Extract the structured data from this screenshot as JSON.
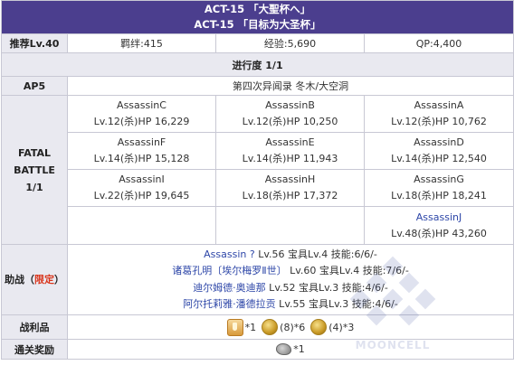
{
  "header": {
    "line1": "ACT-15 「大聖杯へ」",
    "line2": "ACT-15 「目标为大圣杯」"
  },
  "stats": {
    "recommend": "推荐Lv.40",
    "bond": "羁绊:415",
    "exp": "经验:5,690",
    "qp": "QP:4,400"
  },
  "progress": "进行度 1/1",
  "ap": {
    "label": "AP5",
    "location": "第四次异闻录 冬木/大空洞"
  },
  "battle": {
    "label_line1": "FATAL",
    "label_line2": "BATTLE",
    "label_line3": "1/1",
    "rows": [
      [
        {
          "name": "AssassinC",
          "stats": "Lv.12(杀)HP 16,229"
        },
        {
          "name": "AssassinB",
          "stats": "Lv.12(杀)HP 10,250"
        },
        {
          "name": "AssassinA",
          "stats": "Lv.12(杀)HP 10,762"
        }
      ],
      [
        {
          "name": "AssassinF",
          "stats": "Lv.14(杀)HP 15,128"
        },
        {
          "name": "AssassinE",
          "stats": "Lv.14(杀)HP 11,943"
        },
        {
          "name": "AssassinD",
          "stats": "Lv.14(杀)HP 12,540"
        }
      ],
      [
        {
          "name": "AssassinI",
          "stats": "Lv.22(杀)HP 19,645"
        },
        {
          "name": "AssassinH",
          "stats": "Lv.18(杀)HP 17,372"
        },
        {
          "name": "AssassinG",
          "stats": "Lv.18(杀)HP 18,241"
        }
      ],
      [
        {
          "name": "",
          "stats": ""
        },
        {
          "name": "",
          "stats": ""
        },
        {
          "name": "AssassinJ",
          "stats": "Lv.48(杀)HP 43,260"
        }
      ]
    ]
  },
  "support": {
    "label_main": "助战",
    "label_paren_open": "（",
    "label_limited": "限定",
    "label_paren_close": "）",
    "entries": [
      {
        "name": "Assassin ?",
        "rest": " Lv.56 宝具Lv.4 技能:6/6/-"
      },
      {
        "name": "诸葛孔明〔埃尔梅罗Ⅱ世〕",
        "rest": " Lv.60 宝具Lv.4 技能:7/6/-"
      },
      {
        "name": "迪尔姆德·奥迪那",
        "rest": " Lv.52 宝具Lv.3 技能:4/6/-"
      },
      {
        "name": "阿尔托莉雅·潘德拉贡",
        "rest": " Lv.55 宝具Lv.3 技能:4/6/-"
      }
    ]
  },
  "drops": {
    "label": "战利品",
    "items": [
      {
        "icon": "grail-icon",
        "text": "*1"
      },
      {
        "icon": "gold-coin-icon",
        "text": "(8)*6"
      },
      {
        "icon": "gold-coin-icon",
        "text": "(4)*3"
      }
    ]
  },
  "clear_reward": {
    "label": "通关奖励",
    "items": [
      {
        "icon": "ore-icon",
        "text": "*1"
      }
    ]
  },
  "watermark": "MOONCELL",
  "colors": {
    "header_bg": "#4b3e8e",
    "label_bg": "#e9e9f0",
    "link_blue": "#2e47a8",
    "limited_red": "#d9341b"
  }
}
